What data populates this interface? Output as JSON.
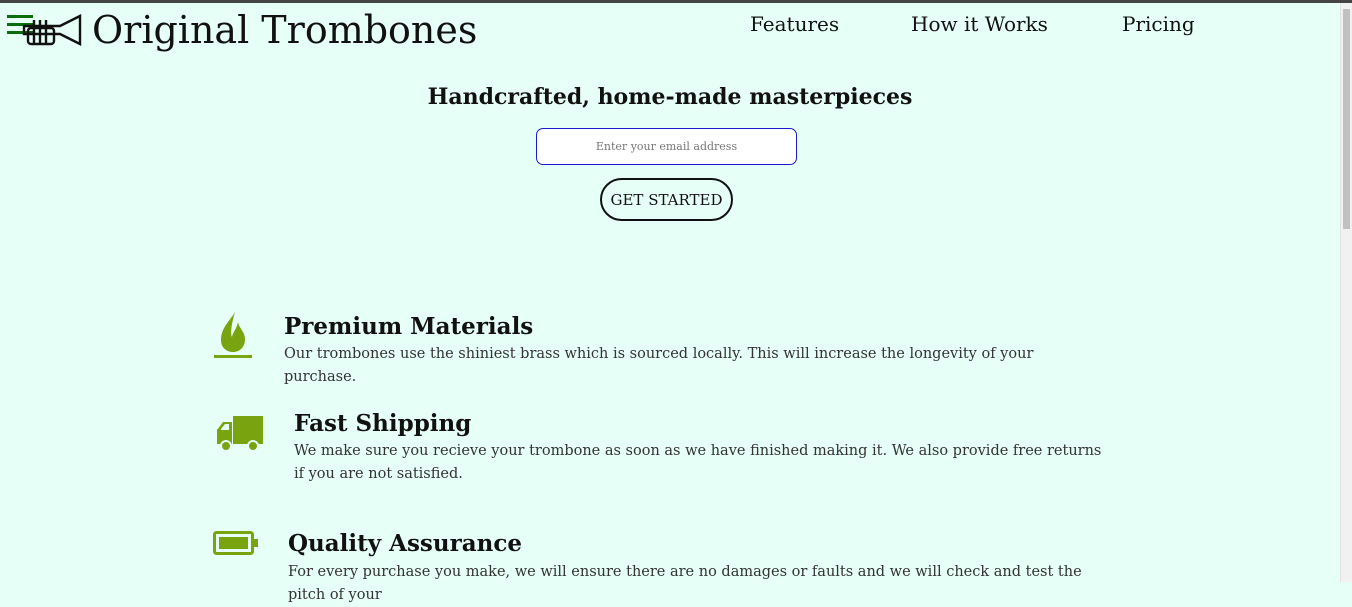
{
  "header": {
    "brand": "Original Trombones",
    "nav": [
      {
        "label": "Features"
      },
      {
        "label": "How it Works"
      },
      {
        "label": "Pricing"
      }
    ]
  },
  "hero": {
    "title": "Handcrafted, home-made masterpieces",
    "email_placeholder": "Enter your email address",
    "button_label": "GET STARTED"
  },
  "features": [
    {
      "title": "Premium Materials",
      "text": "Our trombones use the shiniest brass which is sourced locally. This will increase the longevity of your purchase.",
      "icon": "fire-icon"
    },
    {
      "title": "Fast Shipping",
      "text": "We make sure you recieve your trombone as soon as we have finished making it. We also provide free returns if you are not satisfied.",
      "icon": "truck-icon"
    },
    {
      "title": "Quality Assurance",
      "text": "For every purchase you make, we will ensure there are no damages or faults and we will check and test the pitch of your",
      "icon": "battery-full-icon"
    }
  ],
  "colors": {
    "background": "#e6fff7",
    "icon_green": "#7aa310",
    "hamburger_green": "#0b6d0b",
    "input_border": "#1a1acc"
  }
}
